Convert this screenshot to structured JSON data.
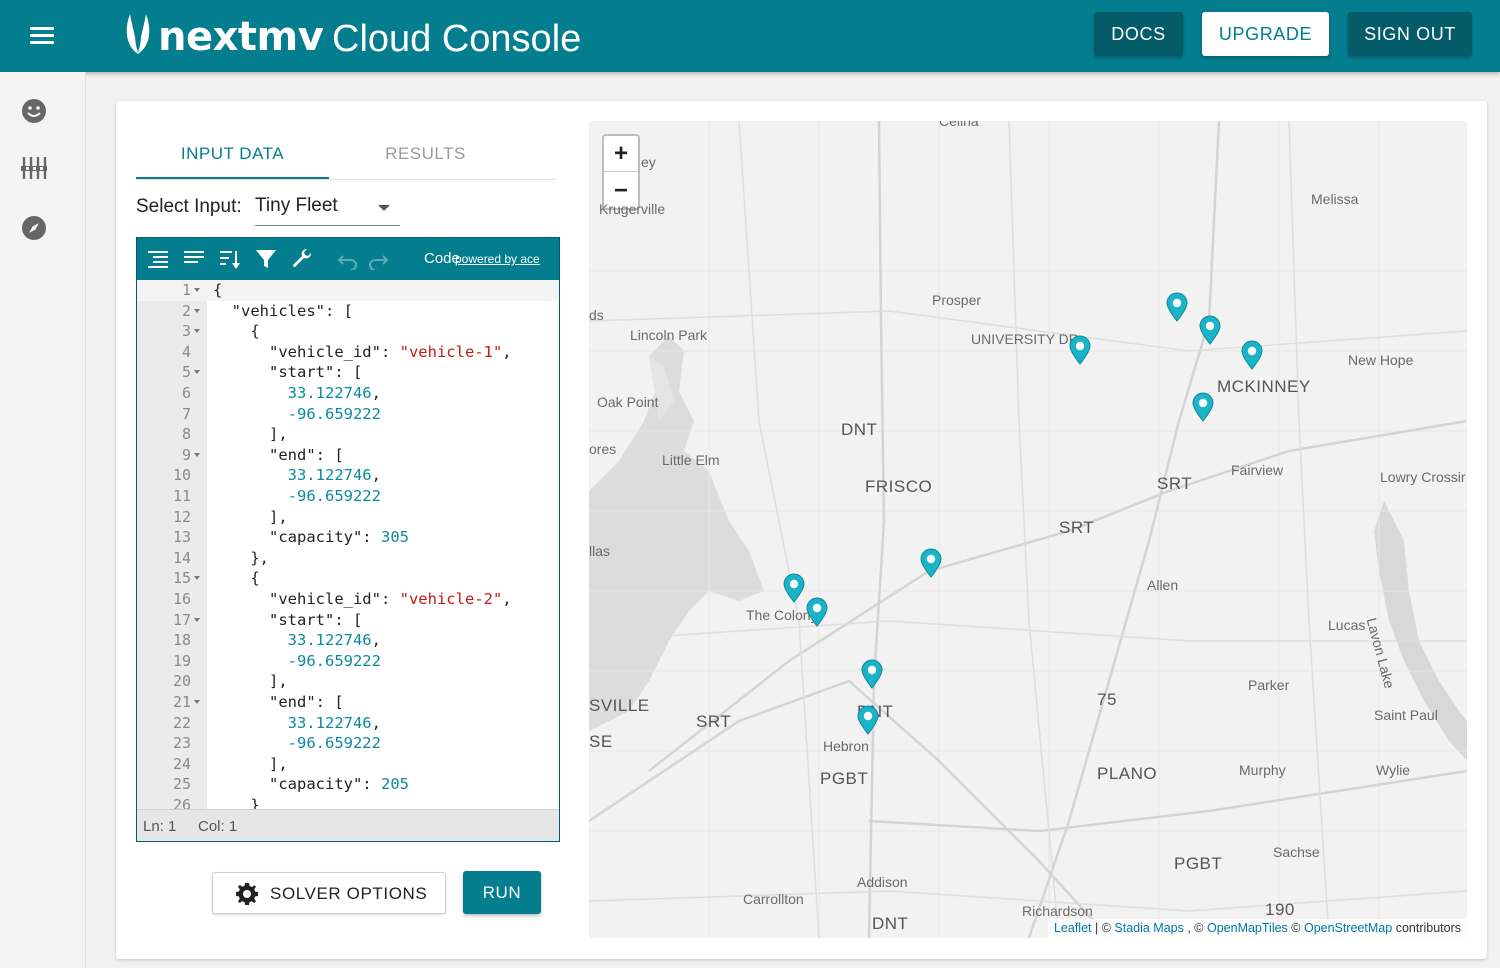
{
  "header": {
    "brand": "nextmv",
    "product": "Cloud Console",
    "buttons": {
      "docs": "DOCS",
      "upgrade": "UPGRADE",
      "sign_out": "SIGN OUT"
    }
  },
  "colors": {
    "primary": "#047d8f",
    "primary_dark": "#045c69",
    "pin": "#1ab3c8"
  },
  "rail": {
    "icons": [
      "face-icon",
      "sliders-icon",
      "compass-icon"
    ]
  },
  "tabs": {
    "input": "INPUT DATA",
    "results": "RESULTS"
  },
  "select": {
    "label": "Select Input:",
    "value": "Tiny Fleet"
  },
  "editor": {
    "toolbar": {
      "code": "Code",
      "powered": "powered by ace"
    },
    "status": {
      "ln": "Ln: 1",
      "col": "Col: 1"
    },
    "lines": [
      {
        "n": "1",
        "fold": true,
        "text": "{"
      },
      {
        "n": "2",
        "fold": true,
        "text": "  \"vehicles\": ["
      },
      {
        "n": "3",
        "fold": true,
        "text": "    {"
      },
      {
        "n": "4",
        "fold": false,
        "text": "      \"vehicle_id\": ",
        "str": "\"vehicle-1\"",
        "tail": ","
      },
      {
        "n": "5",
        "fold": true,
        "text": "      \"start\": ["
      },
      {
        "n": "6",
        "fold": false,
        "text": "        ",
        "num": "33.122746",
        "tail": ","
      },
      {
        "n": "7",
        "fold": false,
        "text": "        ",
        "num": "-96.659222"
      },
      {
        "n": "8",
        "fold": false,
        "text": "      ],"
      },
      {
        "n": "9",
        "fold": true,
        "text": "      \"end\": ["
      },
      {
        "n": "10",
        "fold": false,
        "text": "        ",
        "num": "33.122746",
        "tail": ","
      },
      {
        "n": "11",
        "fold": false,
        "text": "        ",
        "num": "-96.659222"
      },
      {
        "n": "12",
        "fold": false,
        "text": "      ],"
      },
      {
        "n": "13",
        "fold": false,
        "text": "      \"capacity\": ",
        "num": "305"
      },
      {
        "n": "14",
        "fold": false,
        "text": "    },"
      },
      {
        "n": "15",
        "fold": true,
        "text": "    {"
      },
      {
        "n": "16",
        "fold": false,
        "text": "      \"vehicle_id\": ",
        "str": "\"vehicle-2\"",
        "tail": ","
      },
      {
        "n": "17",
        "fold": true,
        "text": "      \"start\": ["
      },
      {
        "n": "18",
        "fold": false,
        "text": "        ",
        "num": "33.122746",
        "tail": ","
      },
      {
        "n": "19",
        "fold": false,
        "text": "        ",
        "num": "-96.659222"
      },
      {
        "n": "20",
        "fold": false,
        "text": "      ],"
      },
      {
        "n": "21",
        "fold": true,
        "text": "      \"end\": ["
      },
      {
        "n": "22",
        "fold": false,
        "text": "        ",
        "num": "33.122746",
        "tail": ","
      },
      {
        "n": "23",
        "fold": false,
        "text": "        ",
        "num": "-96.659222"
      },
      {
        "n": "24",
        "fold": false,
        "text": "      ],"
      },
      {
        "n": "25",
        "fold": false,
        "text": "      \"capacity\": ",
        "num": "205"
      },
      {
        "n": "26",
        "fold": false,
        "text": "    }"
      }
    ]
  },
  "buttons": {
    "solver_options": "SOLVER OPTIONS",
    "run": "RUN"
  },
  "map": {
    "zoom_in": "+",
    "zoom_out": "−",
    "labels": [
      "Celina",
      "Krugerville",
      "Melissa",
      "Prosper",
      "UNIVERSITY DR",
      "Lincoln Park",
      "New Hope",
      "MCKINNEY",
      "Oak Point",
      "DNT",
      "Little Elm",
      "FRISCO",
      "SRT",
      "Fairview",
      "Lowry Crossir",
      "SRT",
      "Allen",
      "The Colony",
      "Lucas",
      "Lavon Lake",
      "Parker",
      "SVILLE",
      "SRT",
      "Hebron",
      "75",
      "Saint Paul",
      "PGBT",
      "PLANO",
      "Murphy",
      "Wylie",
      "Sachse",
      "PGBT",
      "Addison",
      "Carrollton",
      "Richardson",
      "190",
      "DNT",
      "ey",
      "ds",
      "ores",
      "llas",
      "SE",
      "DNT"
    ],
    "attribution": {
      "leaflet": "Leaflet",
      "sep1": " | © ",
      "stadia": "Stadia Maps",
      "sep2": " , © ",
      "omt": "OpenMapTiles",
      "sep3": " © ",
      "osm": "OpenStreetMap",
      "tail": " contributors"
    }
  }
}
